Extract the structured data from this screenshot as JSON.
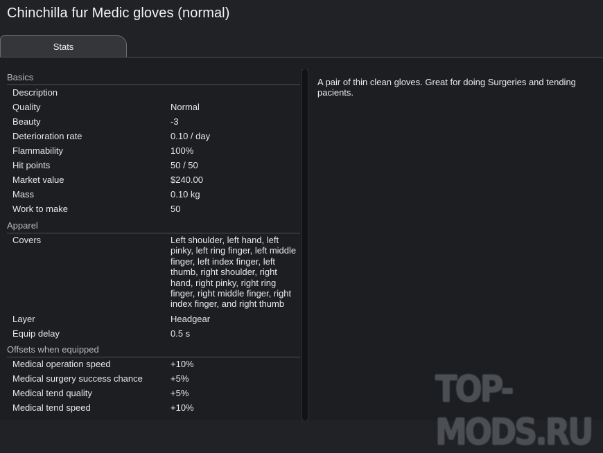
{
  "window": {
    "title": "Chinchilla fur Medic gloves (normal)"
  },
  "tabs": [
    {
      "label": "Stats"
    }
  ],
  "description": "A pair of thin clean gloves. Great for doing Surgeries and tending pacients.",
  "sections": {
    "basics": {
      "header": "Basics",
      "rows": [
        {
          "label": "Description",
          "value": ""
        },
        {
          "label": "Quality",
          "value": "Normal"
        },
        {
          "label": "Beauty",
          "value": "-3"
        },
        {
          "label": "Deterioration rate",
          "value": "0.10 / day"
        },
        {
          "label": "Flammability",
          "value": "100%"
        },
        {
          "label": "Hit points",
          "value": "50 / 50"
        },
        {
          "label": "Market value",
          "value": "$240.00"
        },
        {
          "label": "Mass",
          "value": "0.10 kg"
        },
        {
          "label": "Work to make",
          "value": "50"
        }
      ]
    },
    "apparel": {
      "header": "Apparel",
      "rows": [
        {
          "label": "Covers",
          "value": "Left shoulder, left hand, left pinky, left ring finger, left middle finger, left index finger, left thumb, right shoulder, right hand, right pinky, right ring finger, right middle finger, right index finger, and right thumb"
        },
        {
          "label": "Layer",
          "value": "Headgear"
        },
        {
          "label": "Equip delay",
          "value": "0.5 s"
        }
      ]
    },
    "offsets": {
      "header": "Offsets when equipped",
      "rows": [
        {
          "label": "Medical operation speed",
          "value": "+10%"
        },
        {
          "label": "Medical surgery success chance",
          "value": "+5%"
        },
        {
          "label": "Medical tend quality",
          "value": "+5%"
        },
        {
          "label": "Medical tend speed",
          "value": "+10%"
        }
      ]
    }
  },
  "watermark": "TOP-MODS.RU"
}
